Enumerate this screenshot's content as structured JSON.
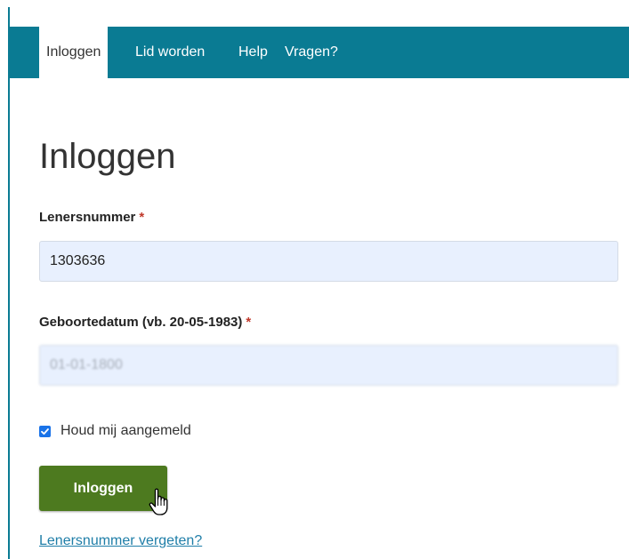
{
  "nav": {
    "items": [
      {
        "label": "Inloggen",
        "active": true
      },
      {
        "label": "Lid worden",
        "active": false
      },
      {
        "label": "Help",
        "active": false
      },
      {
        "label": "Vragen?",
        "active": false
      }
    ]
  },
  "page": {
    "title": "Inloggen"
  },
  "form": {
    "lenersnummer": {
      "label": "Lenersnummer",
      "required_mark": "*",
      "value": "1303636"
    },
    "geboortedatum": {
      "label": "Geboortedatum (vb. 20-05-1983)",
      "required_mark": "*",
      "value": "01-01-1800"
    },
    "remember": {
      "label": "Houd mij aangemeld",
      "checked": true
    },
    "submit_label": "Inloggen",
    "forgot_link": "Lenersnummer vergeten?"
  },
  "colors": {
    "navbar": "#0a7b93",
    "button": "#4d7a1f",
    "link": "#1f7ea8",
    "required": "#c0392b",
    "input_bg": "#e8f0fe"
  }
}
